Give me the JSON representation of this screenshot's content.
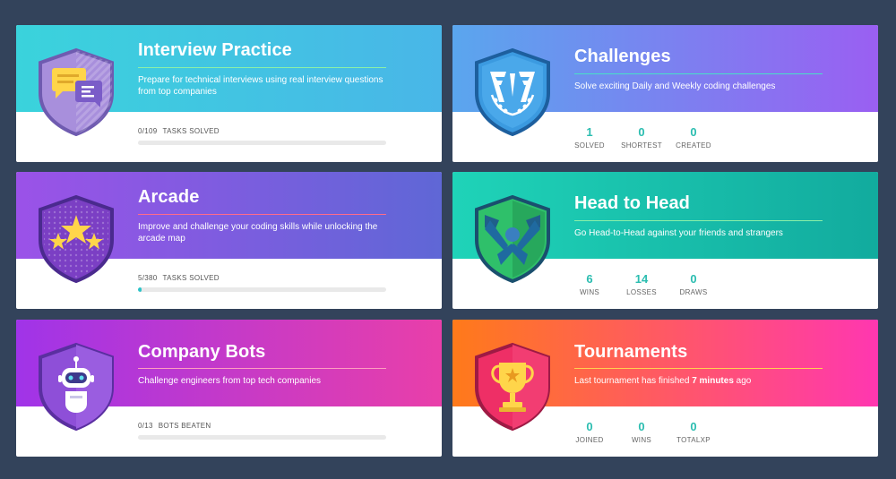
{
  "cards": [
    {
      "title": "Interview Practice",
      "description": "Prepare for technical interviews using real interview questions from top companies",
      "progress_count": "0/109",
      "progress_label": "TASKS SOLVED",
      "progress_fraction": 0.0,
      "icon": "chat-bubbles-icon",
      "gradient": [
        "#3ad3dc",
        "#49b6e8"
      ],
      "rule_color": "#8af0a8"
    },
    {
      "title": "Challenges",
      "description": "Solve exciting Daily and Weekly coding challenges",
      "icon": "cf-laurel-icon",
      "gradient": [
        "#5aa6ee",
        "#9a5ff2"
      ],
      "rule_color": "#48e0c8",
      "stats": [
        {
          "value": "1",
          "label": "SOLVED"
        },
        {
          "value": "0",
          "label": "SHORTEST"
        },
        {
          "value": "0",
          "label": "CREATED"
        }
      ]
    },
    {
      "title": "Arcade",
      "description": "Improve and challenge your coding skills while unlocking the arcade map",
      "progress_count": "5/380",
      "progress_label": "TASKS SOLVED",
      "progress_fraction": 0.013,
      "icon": "stars-icon",
      "gradient": [
        "#9b52e8",
        "#5f67d6"
      ],
      "rule_color": "#ff6b8a"
    },
    {
      "title": "Head to Head",
      "description": "Go Head-to-Head against your friends and strangers",
      "icon": "arm-wrestling-icon",
      "gradient": [
        "#1fd3b8",
        "#12ab9e"
      ],
      "rule_color": "#8af0a8",
      "stats": [
        {
          "value": "6",
          "label": "WINS"
        },
        {
          "value": "14",
          "label": "LOSSES"
        },
        {
          "value": "0",
          "label": "DRAWS"
        }
      ]
    },
    {
      "title": "Company Bots",
      "description": "Challenge engineers from top tech companies",
      "progress_count": "0/13",
      "progress_label": "BOTS BEATEN",
      "progress_fraction": 0.0,
      "icon": "robot-icon",
      "gradient": [
        "#a034e8",
        "#e93fa9"
      ],
      "rule_color": "#ff9ec0"
    },
    {
      "title": "Tournaments",
      "description_prefix": "Last tournament has finished ",
      "description_bold": "7 minutes",
      "description_suffix": " ago",
      "icon": "trophy-icon",
      "gradient": [
        "#ff7a1a",
        "#ff37b0"
      ],
      "rule_color": "#ffd050",
      "stats": [
        {
          "value": "0",
          "label": "JOINED"
        },
        {
          "value": "0",
          "label": "WINS"
        },
        {
          "value": "0",
          "label": "TOTALXP"
        }
      ]
    }
  ]
}
